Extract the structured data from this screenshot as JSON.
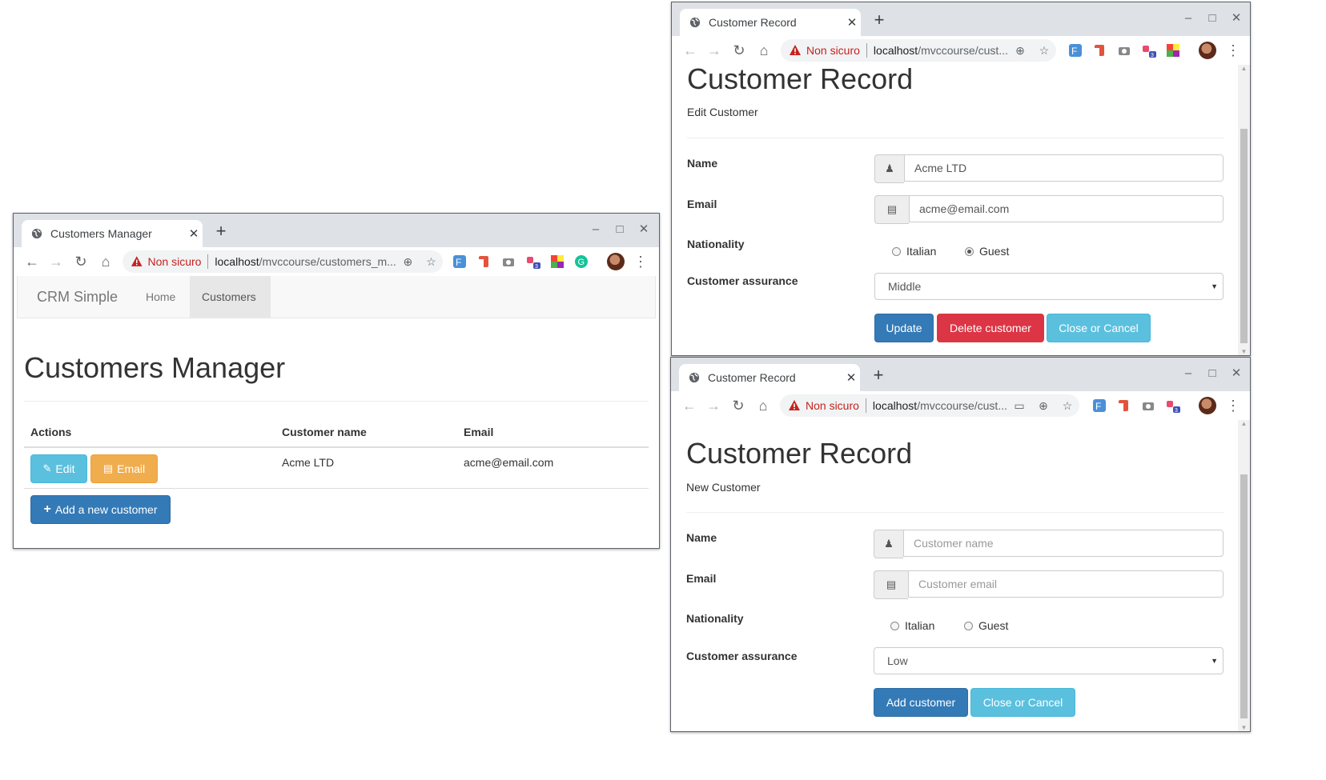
{
  "browser": {
    "security_label": "Non sicuro",
    "host": "localhost",
    "ext_badge": "3",
    "ext_label": "F"
  },
  "manager": {
    "tab_title": "Customers Manager",
    "url_path": "/mvccourse/customers_m...",
    "brand": "CRM Simple",
    "nav": [
      "Home",
      "Customers"
    ],
    "heading": "Customers Manager",
    "columns": [
      "Actions",
      "Customer name",
      "Email"
    ],
    "rows": [
      {
        "name": "Acme LTD",
        "email": "acme@email.com",
        "edit_label": "Edit",
        "email_label": "Email"
      }
    ],
    "add_label": "Add a new customer"
  },
  "edit": {
    "tab_title": "Customer Record",
    "url_path": "/mvccourse/cust...",
    "heading": "Customer Record",
    "subtitle": "Edit Customer",
    "labels": {
      "name": "Name",
      "email": "Email",
      "nationality": "Nationality",
      "assurance": "Customer assurance"
    },
    "name_value": "Acme LTD",
    "email_value": "acme@email.com",
    "radio_options": [
      "Italian",
      "Guest"
    ],
    "selected_nationality": "Guest",
    "assurance_value": "Middle",
    "buttons": {
      "update": "Update",
      "delete": "Delete customer",
      "cancel": "Close or Cancel"
    }
  },
  "create": {
    "tab_title": "Customer Record",
    "url_path": "/mvccourse/cust...",
    "heading": "Customer Record",
    "subtitle": "New Customer",
    "labels": {
      "name": "Name",
      "email": "Email",
      "nationality": "Nationality",
      "assurance": "Customer assurance"
    },
    "name_placeholder": "Customer name",
    "email_placeholder": "Customer email",
    "radio_options": [
      "Italian",
      "Guest"
    ],
    "selected_nationality": "",
    "assurance_value": "Low",
    "buttons": {
      "add": "Add customer",
      "cancel": "Close or Cancel"
    }
  },
  "colors": {
    "primary": "#337ab7",
    "info": "#5bc0de",
    "warning": "#f0ad4e",
    "danger": "#dc3545",
    "insecure": "#c5221f"
  }
}
